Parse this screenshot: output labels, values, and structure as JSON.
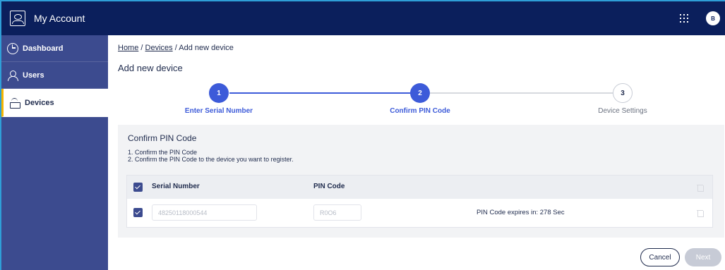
{
  "header": {
    "app_title": "My Account",
    "avatar_initial": "B",
    "app_icon": "account-icon",
    "apps_icon": "apps-grid-icon"
  },
  "sidebar": {
    "items": [
      {
        "label": "Dashboard",
        "icon": "dashboard-icon",
        "active": false
      },
      {
        "label": "Users",
        "icon": "user-icon",
        "active": false
      },
      {
        "label": "Devices",
        "icon": "device-icon",
        "active": true
      }
    ],
    "active_accent": "#f5b400"
  },
  "breadcrumb": {
    "home": "Home",
    "sep1": "/",
    "devices": "Devices",
    "sep2": "/",
    "current": "Add new device"
  },
  "page_title": "Add new device",
  "stepper": {
    "steps": [
      {
        "number": "1",
        "label": "Enter Serial Number",
        "state": "done"
      },
      {
        "number": "2",
        "label": "Confirm PIN Code",
        "state": "current"
      },
      {
        "number": "3",
        "label": "Device Settings",
        "state": "pending"
      }
    ],
    "active_color": "#3d5bd9"
  },
  "panel": {
    "title": "Confirm PIN Code",
    "instructions": [
      "1. Confirm the PIN Code",
      "2. Confirm the PIN Code to the device you want to register."
    ],
    "table": {
      "columns": [
        "Serial Number",
        "PIN Code"
      ],
      "rows": [
        {
          "serial": "48250118000544",
          "pin": "R0O6",
          "expires": "PIN Code expires in: 278 Sec",
          "checked": true
        }
      ]
    }
  },
  "buttons": {
    "cancel": "Cancel",
    "next": "Next"
  },
  "colors": {
    "topbar": "#0b1f5c",
    "sidebar": "#3c4b8f",
    "primary": "#3d5bd9"
  }
}
